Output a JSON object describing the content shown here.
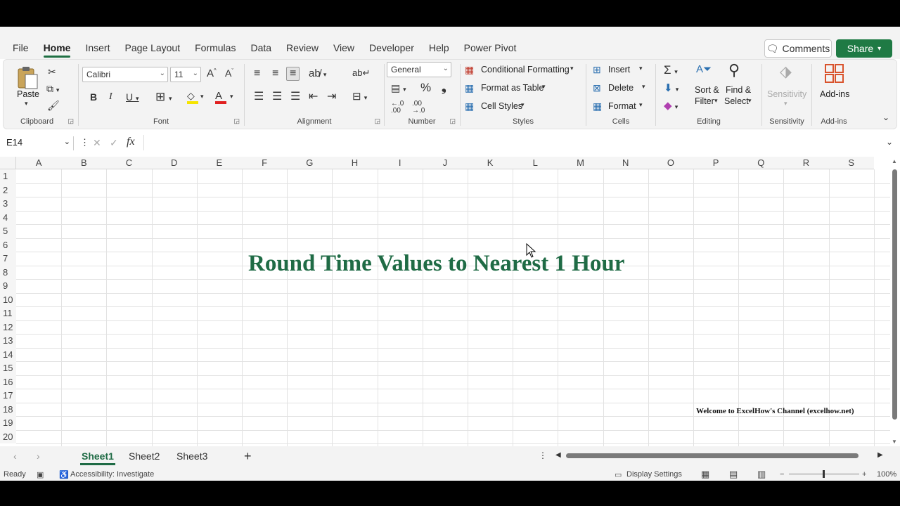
{
  "tabs": [
    "File",
    "Home",
    "Insert",
    "Page Layout",
    "Formulas",
    "Data",
    "Review",
    "View",
    "Developer",
    "Help",
    "Power Pivot"
  ],
  "active_tab": "Home",
  "top_buttons": {
    "comments": "Comments",
    "share": "Share"
  },
  "ribbon": {
    "clipboard": {
      "paste": "Paste",
      "label": "Clipboard"
    },
    "font": {
      "name": "Calibri",
      "size": "11",
      "label": "Font"
    },
    "alignment": {
      "label": "Alignment"
    },
    "number": {
      "format": "General",
      "label": "Number"
    },
    "styles": {
      "conditional": "Conditional Formatting",
      "table": "Format as Table",
      "cell_styles": "Cell Styles",
      "label": "Styles"
    },
    "cells": {
      "insert": "Insert",
      "delete": "Delete",
      "format": "Format",
      "label": "Cells"
    },
    "editing": {
      "sort1": "Sort &",
      "sort2": "Filter",
      "find1": "Find &",
      "find2": "Select",
      "label": "Editing"
    },
    "sensitivity": {
      "button": "Sensitivity",
      "label": "Sensitivity"
    },
    "addins": {
      "button": "Add-ins",
      "label": "Add-ins"
    }
  },
  "formula_bar": {
    "name_box": "E14",
    "fx": "fx",
    "value": ""
  },
  "columns": [
    "A",
    "B",
    "C",
    "D",
    "E",
    "F",
    "G",
    "H",
    "I",
    "J",
    "K",
    "L",
    "M",
    "N",
    "O",
    "P",
    "Q",
    "R",
    "S"
  ],
  "rows": [
    "1",
    "2",
    "3",
    "4",
    "5",
    "6",
    "7",
    "8",
    "9",
    "10",
    "11",
    "12",
    "13",
    "14",
    "15",
    "16",
    "17",
    "18",
    "19",
    "20"
  ],
  "sheet_content": {
    "title": "Round Time Values to Nearest 1 Hour",
    "footer_note": "Welcome to ExcelHow's  Channel (excelhow.net)"
  },
  "sheets": [
    "Sheet1",
    "Sheet2",
    "Sheet3"
  ],
  "active_sheet": "Sheet1",
  "status": {
    "ready": "Ready",
    "accessibility": "Accessibility: Investigate",
    "display": "Display Settings",
    "zoom": "100%"
  },
  "colors": {
    "accent": "#1f6b45",
    "share": "#1f7a44"
  }
}
